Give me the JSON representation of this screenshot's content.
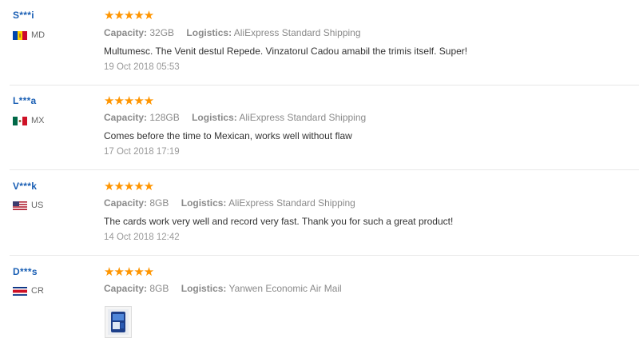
{
  "reviews": [
    {
      "user": "S***i",
      "country": "MD",
      "rating": "★★★★★",
      "capacity_label": "Capacity:",
      "capacity": "32GB",
      "logistics_label": "Logistics:",
      "logistics": "AliExpress Standard Shipping",
      "feedback": "Multumesc. The Venit destul Repede. Vinzatorul Cadou amabil the trimis itself. Super!",
      "date": "19 Oct 2018 05:53"
    },
    {
      "user": "L***a",
      "country": "MX",
      "rating": "★★★★★",
      "capacity_label": "Capacity:",
      "capacity": "128GB",
      "logistics_label": "Logistics:",
      "logistics": "AliExpress Standard Shipping",
      "feedback": "Comes before the time to Mexican, works well without flaw",
      "date": "17 Oct 2018 17:19"
    },
    {
      "user": "V***k",
      "country": "US",
      "rating": "★★★★★",
      "capacity_label": "Capacity:",
      "capacity": "8GB",
      "logistics_label": "Logistics:",
      "logistics": "AliExpress Standard Shipping",
      "feedback": "The cards work very well and record very fast. Thank you for such a great product!",
      "date": "14 Oct 2018 12:42"
    },
    {
      "user": "D***s",
      "country": "CR",
      "rating": "★★★★★",
      "capacity_label": "Capacity:",
      "capacity": "8GB",
      "logistics_label": "Logistics:",
      "logistics": "Yanwen Economic Air Mail"
    }
  ],
  "colors": {
    "star": "#ff9500",
    "username": "#1a5fb4"
  }
}
